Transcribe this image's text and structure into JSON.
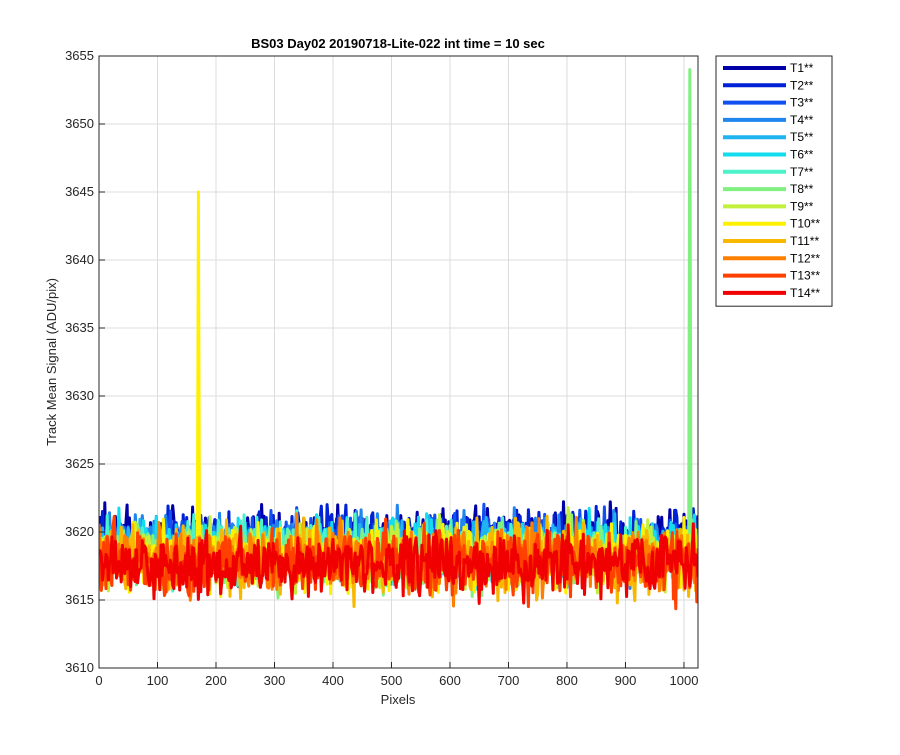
{
  "chart_data": {
    "type": "line",
    "title": "BS03 Day02 20190718-Lite-022 int time = 10 sec",
    "xlabel": "Pixels",
    "ylabel": "Track Mean Signal (ADU/pix)",
    "xlim": [
      0,
      1024
    ],
    "ylim": [
      3610,
      3655
    ],
    "xticks": [
      0,
      100,
      200,
      300,
      400,
      500,
      600,
      700,
      800,
      900,
      1000
    ],
    "yticks": [
      3610,
      3615,
      3620,
      3625,
      3630,
      3635,
      3640,
      3645,
      3650,
      3655
    ],
    "grid": true,
    "legend_position": "outside-top-right",
    "series": [
      {
        "name": "T1**",
        "color": "#0000A8",
        "mean": 3619.6,
        "noise": 1.1
      },
      {
        "name": "T2**",
        "color": "#0022D6",
        "mean": 3619.3,
        "noise": 1.1
      },
      {
        "name": "T3**",
        "color": "#1150F0",
        "mean": 3619.0,
        "noise": 1.1
      },
      {
        "name": "T4**",
        "color": "#1E86EE",
        "mean": 3618.9,
        "noise": 1.1
      },
      {
        "name": "T5**",
        "color": "#1FB4F0",
        "mean": 3618.8,
        "noise": 1.1
      },
      {
        "name": "T6**",
        "color": "#12DCEE",
        "mean": 3618.7,
        "noise": 1.1
      },
      {
        "name": "T7**",
        "color": "#4CF2C8",
        "mean": 3618.6,
        "noise": 1.1
      },
      {
        "name": "T8**",
        "color": "#80F080",
        "mean": 3618.4,
        "noise": 1.1,
        "spike": {
          "x": 1010,
          "y": 3654
        }
      },
      {
        "name": "T9**",
        "color": "#C2F03C",
        "mean": 3618.3,
        "noise": 1.2
      },
      {
        "name": "T10**",
        "color": "#FFF000",
        "mean": 3618.2,
        "noise": 1.2,
        "spike": {
          "x": 170,
          "y": 3645
        }
      },
      {
        "name": "T11**",
        "color": "#F8B800",
        "mean": 3618.0,
        "noise": 1.2
      },
      {
        "name": "T12**",
        "color": "#FF8000",
        "mean": 3617.9,
        "noise": 1.2
      },
      {
        "name": "T13**",
        "color": "#FF4000",
        "mean": 3617.8,
        "noise": 1.2
      },
      {
        "name": "T14**",
        "color": "#F00000",
        "mean": 3617.7,
        "noise": 1.2
      }
    ]
  }
}
